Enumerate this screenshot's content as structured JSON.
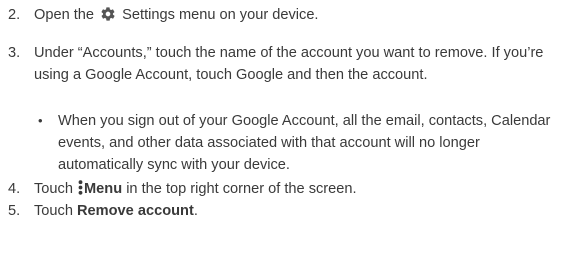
{
  "steps": [
    {
      "number": "2.",
      "before": "Open the",
      "icon": "gear-icon",
      "after": "Settings menu on your device."
    },
    {
      "number": "3.",
      "text": "Under “Accounts,” touch the name of the account you want to remove. If you’re using a Google Account, touch Google and then the account.",
      "bullets": [
        "When you sign out of your Google Account, all the email, contacts, Calendar events, and other data associated with that account will no longer automatically sync with your device."
      ]
    },
    {
      "number": "4.",
      "before": "Touch",
      "icon": "menu-dots-icon",
      "bold": "Menu",
      "after": "in the top right corner of the screen."
    },
    {
      "number": "5.",
      "before": "Touch",
      "bold": "Remove account",
      "after": "."
    }
  ],
  "bullet_glyph": "•",
  "colors": {
    "text": "#3a3a3a",
    "icon": "#555555",
    "background": "#ffffff"
  }
}
